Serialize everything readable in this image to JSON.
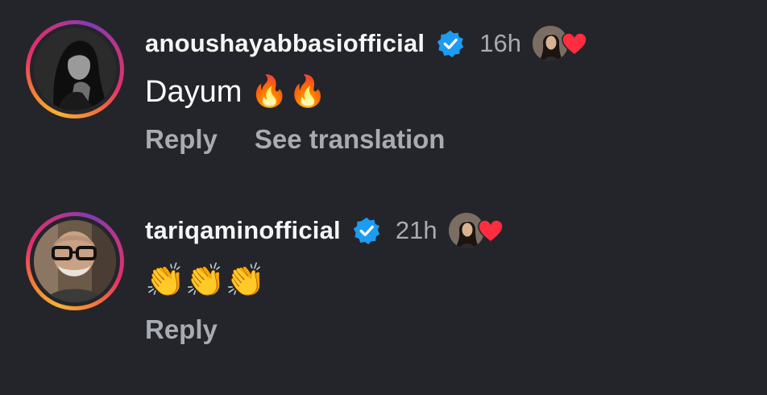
{
  "comments": [
    {
      "username": "anoushayabbasiofficial",
      "time": "16h",
      "text": "Dayum 🔥🔥",
      "reply_label": "Reply",
      "translation_label": "See translation",
      "verified": true,
      "liked_by_creator": true
    },
    {
      "username": "tariqaminofficial",
      "time": "21h",
      "text": "👏👏👏",
      "reply_label": "Reply",
      "verified": true,
      "liked_by_creator": true
    }
  ],
  "colors": {
    "background": "#24252a",
    "verified_badge": "#1d9bf0",
    "heart": "#ff2d3f",
    "muted_text": "#a8abb2"
  },
  "icons": [
    "verified-badge-icon",
    "heart-icon"
  ]
}
